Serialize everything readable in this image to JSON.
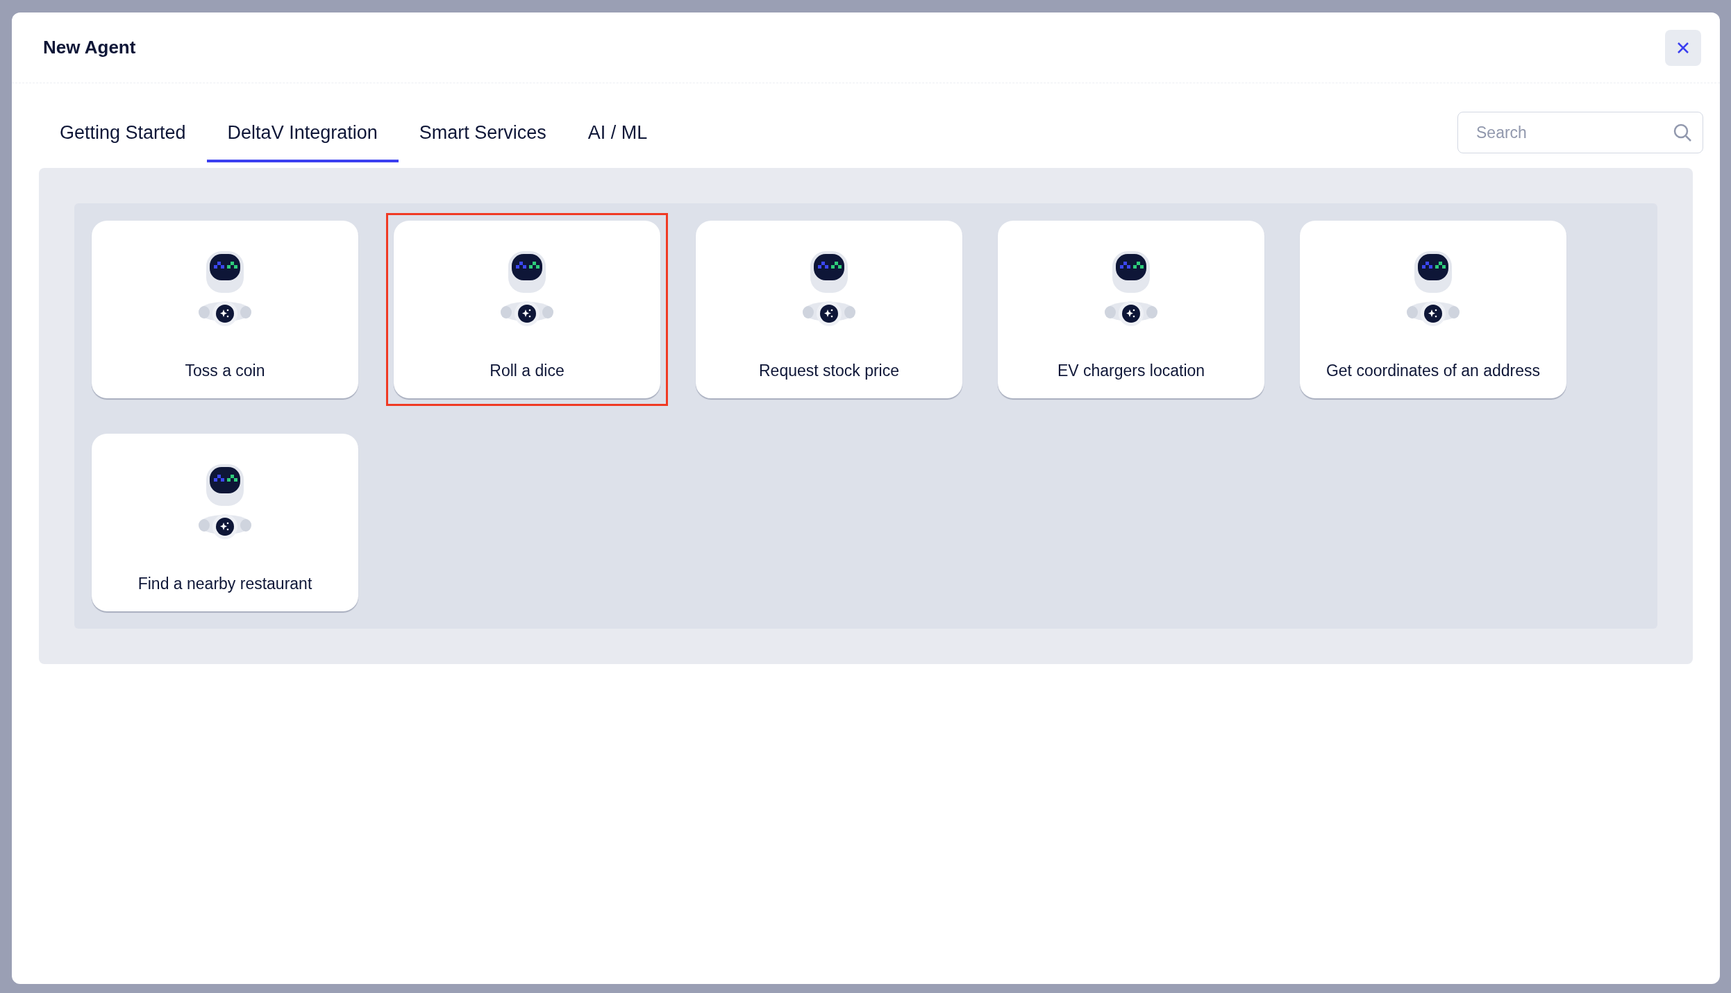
{
  "window": {
    "title": "New Agent"
  },
  "tabs": [
    {
      "label": "Getting Started",
      "selected": false
    },
    {
      "label": "DeltaV Integration",
      "selected": true
    },
    {
      "label": "Smart Services",
      "selected": false
    },
    {
      "label": "AI / ML",
      "selected": false
    }
  ],
  "search": {
    "placeholder": "Search"
  },
  "agents": [
    {
      "label": "Toss a coin",
      "highlighted": false
    },
    {
      "label": "Roll a dice",
      "highlighted": true
    },
    {
      "label": "Request stock price",
      "highlighted": false
    },
    {
      "label": "EV chargers location",
      "highlighted": false
    },
    {
      "label": "Get coordinates of an address",
      "highlighted": false
    },
    {
      "label": "Find a nearby restaurant",
      "highlighted": false
    }
  ]
}
